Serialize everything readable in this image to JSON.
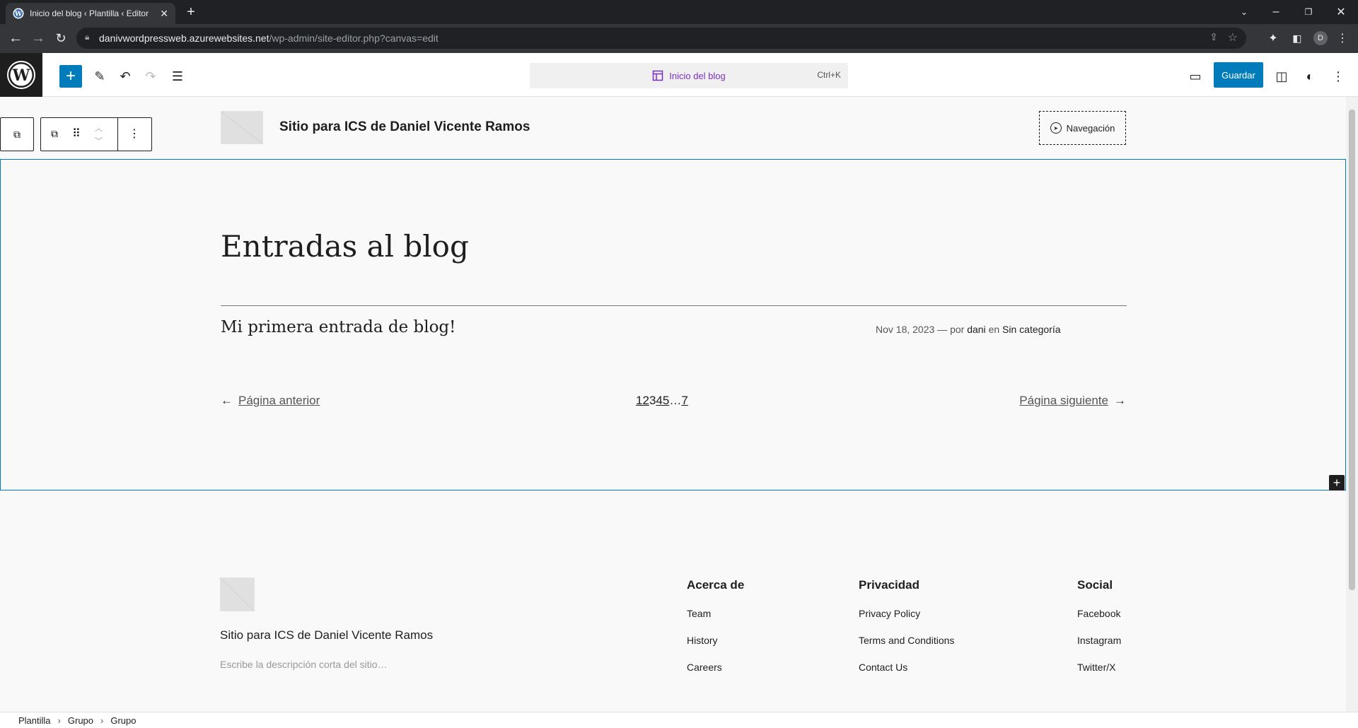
{
  "browser": {
    "tab_title": "Inicio del blog ‹ Plantilla ‹ Editor",
    "url_host": "danivwordpressweb.azurewebsites.net",
    "url_path": "/wp-admin/site-editor.php?canvas=edit",
    "profile_initial": "D"
  },
  "editor": {
    "command_label": "Inicio del blog",
    "command_shortcut": "Ctrl+K",
    "save_label": "Guardar"
  },
  "header": {
    "site_title": "Sitio para ICS de Daniel Vicente Ramos",
    "nav_label": "Navegación"
  },
  "main": {
    "heading": "Entradas al blog",
    "post_title": "Mi primera entrada de blog!",
    "post_date": "Nov 18, 2023",
    "post_meta_sep": "— por",
    "post_author": "dani",
    "post_meta_in": "en",
    "post_category": "Sin categoría",
    "prev_label": "Página anterior",
    "next_label": "Página siguiente",
    "pages": [
      "1",
      "2",
      "3",
      "4",
      "5",
      "…",
      "7"
    ]
  },
  "footer": {
    "site_title": "Sitio para ICS de Daniel Vicente Ramos",
    "tagline_placeholder": "Escribe la descripción corta del sitio…",
    "columns": [
      {
        "heading": "Acerca de",
        "links": [
          "Team",
          "History",
          "Careers"
        ]
      },
      {
        "heading": "Privacidad",
        "links": [
          "Privacy Policy",
          "Terms and Conditions",
          "Contact Us"
        ]
      },
      {
        "heading": "Social",
        "links": [
          "Facebook",
          "Instagram",
          "Twitter/X"
        ]
      }
    ]
  },
  "breadcrumb": [
    "Plantilla",
    "Grupo",
    "Grupo"
  ],
  "colors": {
    "accent": "#007cba",
    "command_text": "#7b2fbe"
  }
}
